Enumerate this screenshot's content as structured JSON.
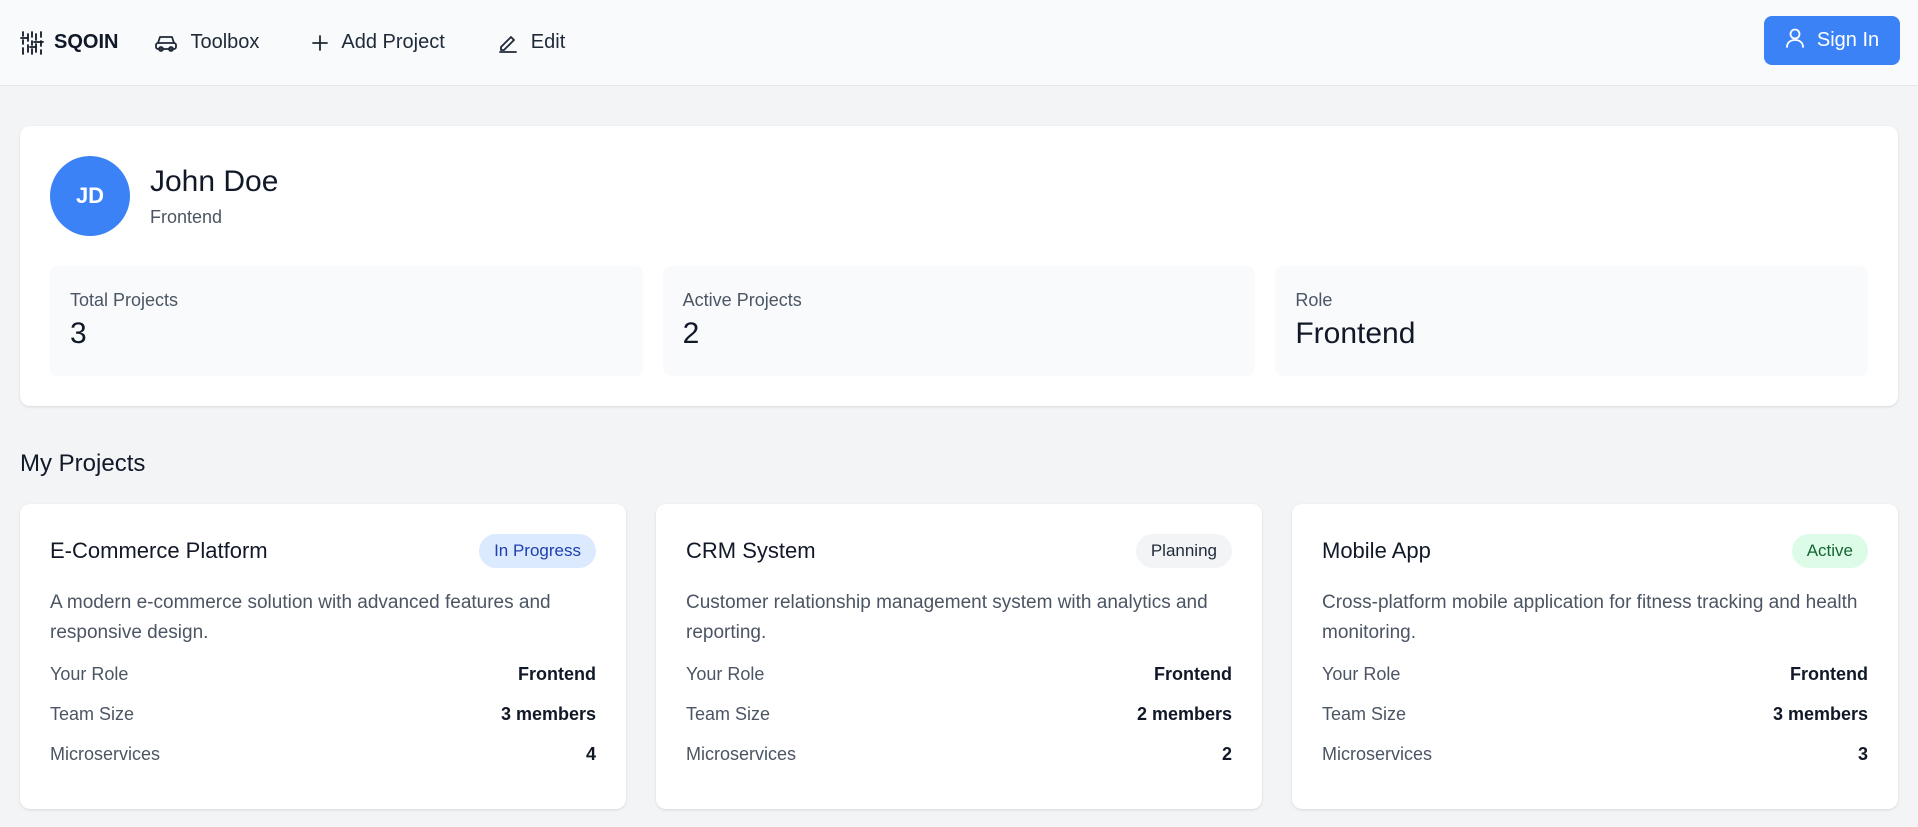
{
  "nav": {
    "brand": "SQOIN",
    "items": [
      {
        "label": "Toolbox",
        "icon": "car-icon"
      },
      {
        "label": "Add Project",
        "icon": "plus-icon"
      },
      {
        "label": "Edit",
        "icon": "pencil-icon"
      }
    ],
    "signin": "Sign In"
  },
  "profile": {
    "initials": "JD",
    "name": "John Doe",
    "role": "Frontend",
    "stats": [
      {
        "label": "Total Projects",
        "value": "3"
      },
      {
        "label": "Active Projects",
        "value": "2"
      },
      {
        "label": "Role",
        "value": "Frontend"
      }
    ]
  },
  "projects_section": {
    "title": "My Projects",
    "labels": {
      "role": "Your Role",
      "team": "Team Size",
      "micro": "Microservices"
    },
    "items": [
      {
        "title": "E-Commerce Platform",
        "status": "In Progress",
        "description": "A modern e-commerce solution with advanced features and responsive design.",
        "role": "Frontend",
        "team": "3 members",
        "micro": "4"
      },
      {
        "title": "CRM System",
        "status": "Planning",
        "description": "Customer relationship management system with analytics and reporting.",
        "role": "Frontend",
        "team": "2 members",
        "micro": "2"
      },
      {
        "title": "Mobile App",
        "status": "Active",
        "description": "Cross-platform mobile application for fitness tracking and health monitoring.",
        "role": "Frontend",
        "team": "3 members",
        "micro": "3"
      }
    ]
  },
  "colors": {
    "accent": "#3b82f6",
    "badge_in_progress": "#dbeafe",
    "badge_planning": "#f3f4f6",
    "badge_active": "#dcfce7"
  }
}
